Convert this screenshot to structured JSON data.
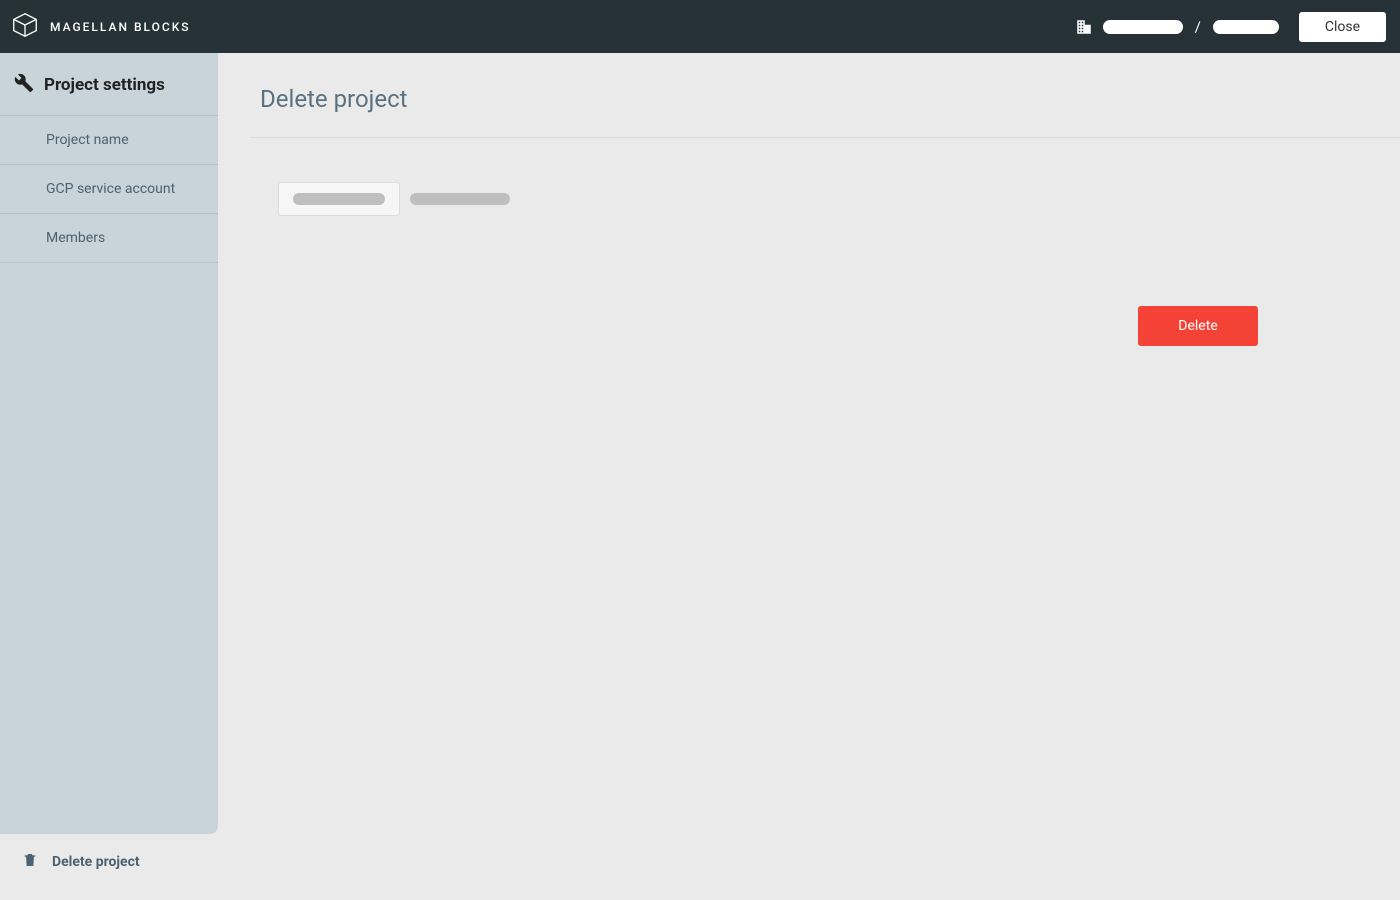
{
  "header": {
    "brand": "MAGELLAN BLOCKS",
    "close_label": "Close"
  },
  "sidebar": {
    "title": "Project settings",
    "items": [
      {
        "label": "Project name"
      },
      {
        "label": "GCP service account"
      },
      {
        "label": "Members"
      }
    ]
  },
  "footer": {
    "delete_label": "Delete project"
  },
  "page": {
    "title": "Delete project",
    "delete_button": "Delete"
  }
}
